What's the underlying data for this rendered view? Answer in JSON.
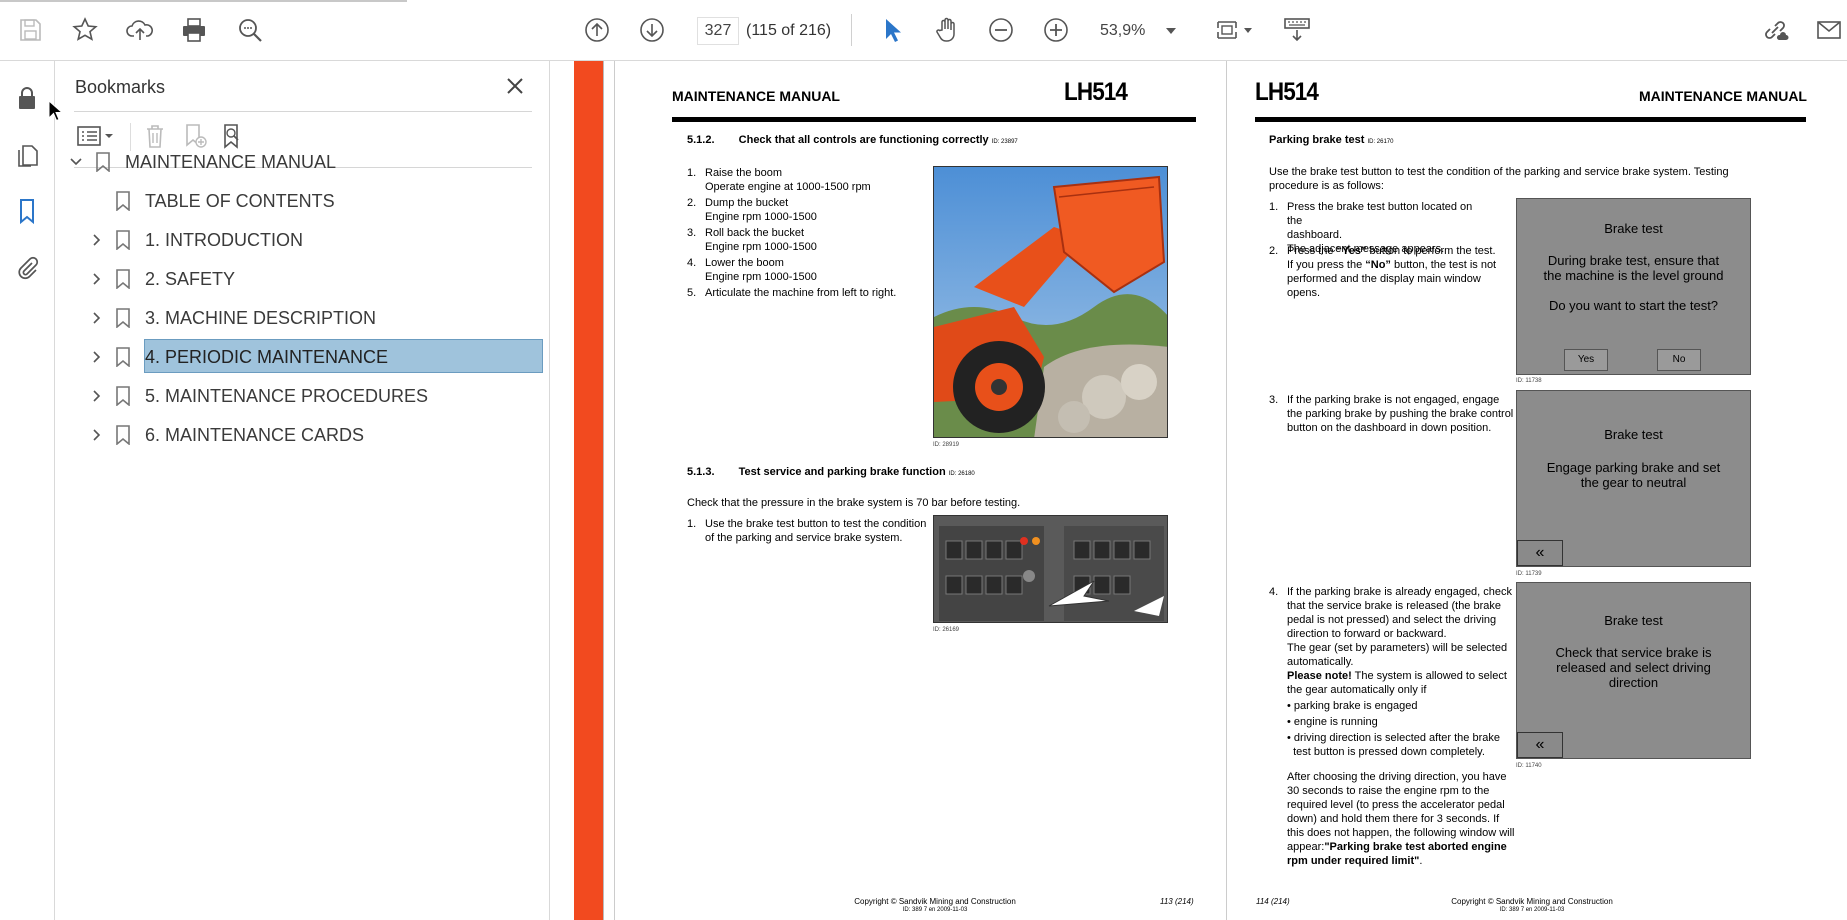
{
  "toolbar": {
    "page_value": "327",
    "page_count": "(115 of 216)",
    "zoom": "53,9%"
  },
  "bookmarks": {
    "title": "Bookmarks",
    "items": [
      {
        "label": "MAINTENANCE MANUAL",
        "level": 0,
        "expanded": true
      },
      {
        "label": "TABLE OF CONTENTS",
        "level": 1
      },
      {
        "label": "1. INTRODUCTION",
        "level": 1
      },
      {
        "label": "2. SAFETY",
        "level": 1
      },
      {
        "label": "3. MACHINE DESCRIPTION",
        "level": 1
      },
      {
        "label": "4. PERIODIC MAINTENANCE",
        "level": 1,
        "selected": true
      },
      {
        "label": "5. MAINTENANCE PROCEDURES",
        "level": 1
      },
      {
        "label": "6. MAINTENANCE CARDS",
        "level": 1
      }
    ]
  },
  "colors": {
    "accent": "#2b76c9",
    "orange_bar": "#f24a1f",
    "selection": "#9fc3dc"
  },
  "left_page": {
    "header_title": "MAINTENANCE MANUAL",
    "brand": "LH514",
    "s1_num": "5.1.2.",
    "s1_title": "Check that all controls are functioning correctly",
    "s1_id": "ID: 23897",
    "steps": [
      {
        "n": "1.",
        "a": "Raise the boom",
        "b": "Operate engine at 1000-1500 rpm"
      },
      {
        "n": "2.",
        "a": "Dump the bucket",
        "b": "Engine rpm 1000-1500"
      },
      {
        "n": "3.",
        "a": "Roll back the bucket",
        "b": "Engine rpm 1000-1500"
      },
      {
        "n": "4.",
        "a": "Lower the boom",
        "b": "Engine rpm 1000-1500"
      },
      {
        "n": "5.",
        "a": "Articulate the machine from left to right.",
        "b": ""
      }
    ],
    "photo1_id": "ID: 28919",
    "s2_num": "5.1.3.",
    "s2_title": "Test service and parking brake function",
    "s2_id": "ID: 26180",
    "s2_text": "Check that the pressure in the brake system is 70 bar before testing.",
    "s2_step_n": "1.",
    "s2_step_l1": "Use the brake test button to test the condition",
    "s2_step_l2": "of the parking and service brake system.",
    "photo2_id": "ID: 26169",
    "footer_l1": "Copyright © Sandvik Mining and Construction",
    "footer_l2": "ID: 389 7 en 2009-11-03",
    "page_num": "113 (214)"
  },
  "right_page": {
    "brand": "LH514",
    "header_title": "MAINTENANCE MANUAL",
    "s_title": "Parking brake test",
    "s_id": "ID: 26170",
    "intro_l1": "Use the brake test button to test the condition of the parking and service brake system. Testing",
    "intro_l2": "procedure is as follows:",
    "st1_n": "1.",
    "st1_l1": "Press the brake test button located on the",
    "st1_l2": "dashboard.",
    "st1_l3": "The adjacent message appears.",
    "st2_n": "2.",
    "st2_l1a": "Press the ",
    "st2_l1b": "“Yes”",
    "st2_l1c": " button to perform the test.",
    "st2_l2a": "If you press the ",
    "st2_l2b": "“No”",
    "st2_l2c": " button, the test is not",
    "st2_l3": "performed and the display main window",
    "st2_l4": "opens.",
    "screen1": {
      "title": "Brake test",
      "l1": "During brake test, ensure that",
      "l2": "the machine is the level ground",
      "l3": "Do you want to start the test?",
      "yes": "Yes",
      "no": "No",
      "id": "ID: 11738"
    },
    "st3_n": "3.",
    "st3_l1": "If the parking brake is not engaged, engage",
    "st3_l2": "the parking brake by pushing the brake control",
    "st3_l3": "button on the dashboard in down position.",
    "screen2": {
      "title": "Brake test",
      "l1": "Engage parking brake and set",
      "l2": "the gear to neutral",
      "back": "«",
      "id": "ID: 11739"
    },
    "st4_n": "4.",
    "st4_lines": [
      "If the parking brake is already engaged, check",
      "that the service brake is released (the brake",
      "pedal is not pressed) and select the driving",
      "direction to forward or backward.",
      "The gear (set by parameters) will be selected",
      "automatically."
    ],
    "note_b": "Please note!",
    "note_r": " The system is allowed to select",
    "note_l2": "the gear automatically only if",
    "bullets": [
      "parking brake is engaged",
      "engine is running",
      "driving direction is selected after the brake"
    ],
    "bullet3_l2": "test button is pressed down completely.",
    "screen3": {
      "title": "Brake test",
      "l1": "Check that service brake is",
      "l2": "released and select driving",
      "l3": "direction",
      "back": "«",
      "id": "ID: 11740"
    },
    "after_lines": [
      "After choosing the driving direction, you have",
      "30 seconds to raise the engine rpm to the",
      "required level (to press the accelerator pedal",
      "down) and hold them there for 3 seconds. If",
      "this does not happen, the following window will"
    ],
    "after_l6a": "appear:",
    "after_l6b": "\"Parking brake test aborted engine",
    "after_l7": "rpm under required limit\"",
    "after_l7c": ".",
    "page_num": "114 (214)",
    "footer_l1": "Copyright © Sandvik Mining and Construction",
    "footer_l2": "ID: 389 7 en 2009-11-03"
  }
}
